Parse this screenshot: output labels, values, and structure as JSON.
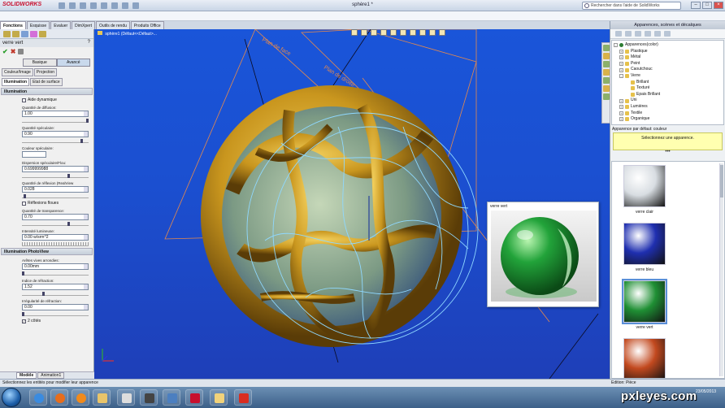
{
  "window": {
    "logo": "SOLIDWORKS",
    "doc_title": "sphère1 *",
    "help_placeholder": "Rechercher dans l'aide de SolidWorks"
  },
  "command_tabs": [
    "Fonctions",
    "Esquisse",
    "Evaluer",
    "DimXpert",
    "Outils de rendu",
    "Produits Office"
  ],
  "left_panel": {
    "header": "verre vert",
    "help_glyph": "?",
    "mode_tabs": [
      "Basique",
      "Avancé"
    ],
    "subtabs_row1": [
      "Couleur/Image",
      "Projection"
    ],
    "subtabs_row2": [
      "Illumination",
      "Etat de surface"
    ],
    "sections": {
      "illumination": "Illumination",
      "photoview": "Illumination PhotoView"
    },
    "fields": {
      "aide_dynamique": "Aide dynamique",
      "diffusion_label": "Quantité de diffusion:",
      "diffusion_value": "1.00",
      "speculaire_label": "Quantité spéculaire:",
      "speculaire_value": "0.90",
      "couleur_spec_label": "Couleur spéculaire:",
      "dispersion_label": "Dispersion spéculaire/Flou:",
      "dispersion_value": "0.699999988",
      "reflexion_label": "Quantité de réflexion (RealView",
      "reflexion_value": "0.028",
      "reflexions_floues": "Réflexions floues",
      "transparence_label": "Quantité de transparence:",
      "transparence_value": "0.70",
      "intensite_label": "Intensité lumineuse:",
      "intensite_value": "0.00 w/srm^2",
      "aretes_label": "Arêtes vives arrondies:",
      "aretes_value": "0.00mm",
      "refraction_label": "Indice de réfraction:",
      "refraction_value": "1.52",
      "irregularite_label": "Irrégularité de réfraction:",
      "irregularite_value": "0.00",
      "deux_cotes": "2 côtés"
    },
    "bottom_tabs": [
      "Modèle",
      "Animation1"
    ]
  },
  "viewport": {
    "tree_item": "sphère1 (Défaut<<Défaut>...",
    "plane_front": "Plan de face",
    "plane_right": "Plan de droite",
    "preview_title": "verre vert"
  },
  "right_panel": {
    "title": "Apparences, scènes et décalques",
    "tree": [
      {
        "label": "Apparences(color)",
        "level": 0,
        "toggle": "-",
        "icon": "globe"
      },
      {
        "label": "Plastique",
        "level": 1,
        "toggle": "+",
        "icon": "folder"
      },
      {
        "label": "Métal",
        "level": 1,
        "toggle": "+",
        "icon": "folder"
      },
      {
        "label": "Peint",
        "level": 1,
        "toggle": "+",
        "icon": "folder"
      },
      {
        "label": "Caoutchouc",
        "level": 1,
        "toggle": "+",
        "icon": "folder"
      },
      {
        "label": "Verre",
        "level": 1,
        "toggle": "-",
        "icon": "folder"
      },
      {
        "label": "Brillant",
        "level": 2,
        "toggle": "",
        "icon": "folder"
      },
      {
        "label": "Texturé",
        "level": 2,
        "toggle": "",
        "icon": "folder"
      },
      {
        "label": "Epais Brillant",
        "level": 2,
        "toggle": "",
        "icon": "folder"
      },
      {
        "label": "Uni",
        "level": 1,
        "toggle": "+",
        "icon": "folder"
      },
      {
        "label": "Lumières",
        "level": 1,
        "toggle": "+",
        "icon": "folder"
      },
      {
        "label": "Textile",
        "level": 1,
        "toggle": "+",
        "icon": "folder"
      },
      {
        "label": "Organique",
        "level": 1,
        "toggle": "+",
        "icon": "folder"
      }
    ],
    "default_label": "Apparence par défaut: couleur",
    "select_hint": "Sélectionnez une apparence.",
    "dots": "•••",
    "gallery": [
      {
        "label": "verre clair",
        "color": "#d8dde2"
      },
      {
        "label": "verre bleu",
        "color": "#1f2fb0"
      },
      {
        "label": "verre vert",
        "color": "#1f8f34"
      },
      {
        "label": "",
        "color": "#c2491f"
      }
    ]
  },
  "status": {
    "left": "Sélectionnez les entités pour modifier leur apparence",
    "right": "Edition: Pièce"
  },
  "taskbar": {
    "clock_date": "23/05/2013"
  },
  "watermark": "pxleyes.com",
  "colors": {
    "viewport_bg": "#1a55d9",
    "gold": "#c9961e",
    "outline_cyan": "#8fd8ff",
    "glass_green": "#22a33a"
  }
}
